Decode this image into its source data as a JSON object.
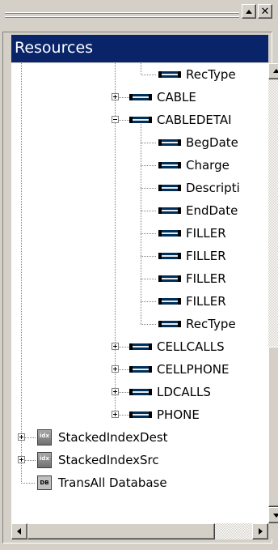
{
  "panel": {
    "title": "Resources",
    "title_bg": "#0a246a",
    "buttons": {
      "scroll_up_icon": "triangle-up",
      "close_icon": "x",
      "close_label": "✕"
    }
  },
  "tree": {
    "nodes": [
      {
        "label": "RecType",
        "kind": "field",
        "expander": "none"
      },
      {
        "label": "CABLE",
        "kind": "field",
        "expander": "plus"
      },
      {
        "label": "CABLEDETAI",
        "kind": "field",
        "expander": "minus"
      },
      {
        "label": "BegDate",
        "kind": "field",
        "expander": "none"
      },
      {
        "label": "Charge",
        "kind": "field",
        "expander": "none"
      },
      {
        "label": "Descripti",
        "kind": "field",
        "expander": "none"
      },
      {
        "label": "EndDate",
        "kind": "field",
        "expander": "none"
      },
      {
        "label": "FILLER",
        "kind": "field",
        "expander": "none"
      },
      {
        "label": "FILLER",
        "kind": "field",
        "expander": "none"
      },
      {
        "label": "FILLER",
        "kind": "field",
        "expander": "none"
      },
      {
        "label": "FILLER",
        "kind": "field",
        "expander": "none"
      },
      {
        "label": "RecType",
        "kind": "field",
        "expander": "none"
      },
      {
        "label": "CELLCALLS",
        "kind": "field",
        "expander": "plus"
      },
      {
        "label": "CELLPHONE",
        "kind": "field",
        "expander": "plus"
      },
      {
        "label": "LDCALLS",
        "kind": "field",
        "expander": "plus"
      },
      {
        "label": "PHONE",
        "kind": "field",
        "expander": "plus"
      },
      {
        "label": "StackedIndexDest",
        "kind": "index",
        "expander": "plus",
        "icon_text": "idx"
      },
      {
        "label": "StackedIndexSrc",
        "kind": "index",
        "expander": "plus",
        "icon_text": "idx"
      },
      {
        "label": "TransAll Database",
        "kind": "database",
        "expander": "none",
        "icon_text": "DB"
      }
    ]
  },
  "scrollbars": {
    "vertical": {
      "position": 0.65
    },
    "horizontal": {
      "position": 0.0
    }
  },
  "colors": {
    "face": "#d4d0c8",
    "selection": "#0a246a",
    "tree_bg": "#ffffff"
  }
}
